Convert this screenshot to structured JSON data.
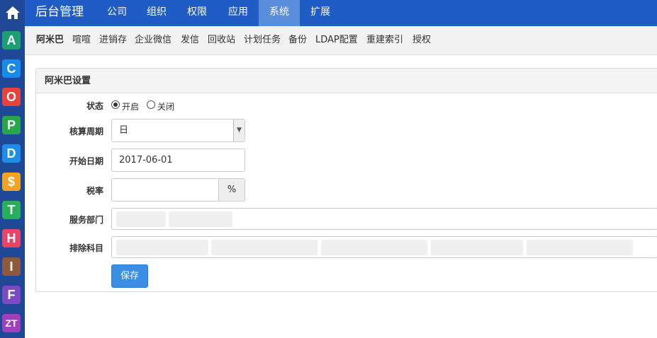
{
  "topnav": {
    "brand": "后台管理",
    "items": [
      "公司",
      "组织",
      "权限",
      "应用",
      "系统",
      "扩展"
    ],
    "active": "系统"
  },
  "appbar": {
    "apps": [
      {
        "letter": "A",
        "color": "#1a9f73"
      },
      {
        "letter": "C",
        "color": "#1789e6"
      },
      {
        "letter": "O",
        "color": "#e9413a"
      },
      {
        "letter": "P",
        "color": "#26a74b"
      },
      {
        "letter": "D",
        "color": "#1c8ee8"
      },
      {
        "letter": "$",
        "color": "#f3a322"
      },
      {
        "letter": "T",
        "color": "#27b05b"
      },
      {
        "letter": "H",
        "color": "#ec4267"
      },
      {
        "letter": "I",
        "color": "#8e5a3d"
      },
      {
        "letter": "F",
        "color": "#7b4bc4"
      },
      {
        "letter": "ZT",
        "color": "#a23fbd"
      }
    ]
  },
  "subnav": {
    "items": [
      "阿米巴",
      "喧喧",
      "进销存",
      "企业微信",
      "发信",
      "回收站",
      "计划任务",
      "备份",
      "LDAP配置",
      "重建索引",
      "授权"
    ],
    "active": "阿米巴"
  },
  "panel": {
    "title": "阿米巴设置",
    "status": {
      "label": "状态",
      "options": [
        "开启",
        "关闭"
      ],
      "selected": "开启"
    },
    "period": {
      "label": "核算周期",
      "value": "日"
    },
    "start_date": {
      "label": "开始日期",
      "value": "2017-06-01"
    },
    "tax": {
      "label": "税率",
      "value": "",
      "unit": "%"
    },
    "service_dept": {
      "label": "服务部门"
    },
    "exclude_subjects": {
      "label": "排除科目"
    },
    "save_label": "保存"
  },
  "colors": {
    "topnav": "#1f5cc6",
    "topnav_active": "#5a8ddc",
    "appbar": "#1f4896",
    "primary_button": "#3a8ee6"
  }
}
